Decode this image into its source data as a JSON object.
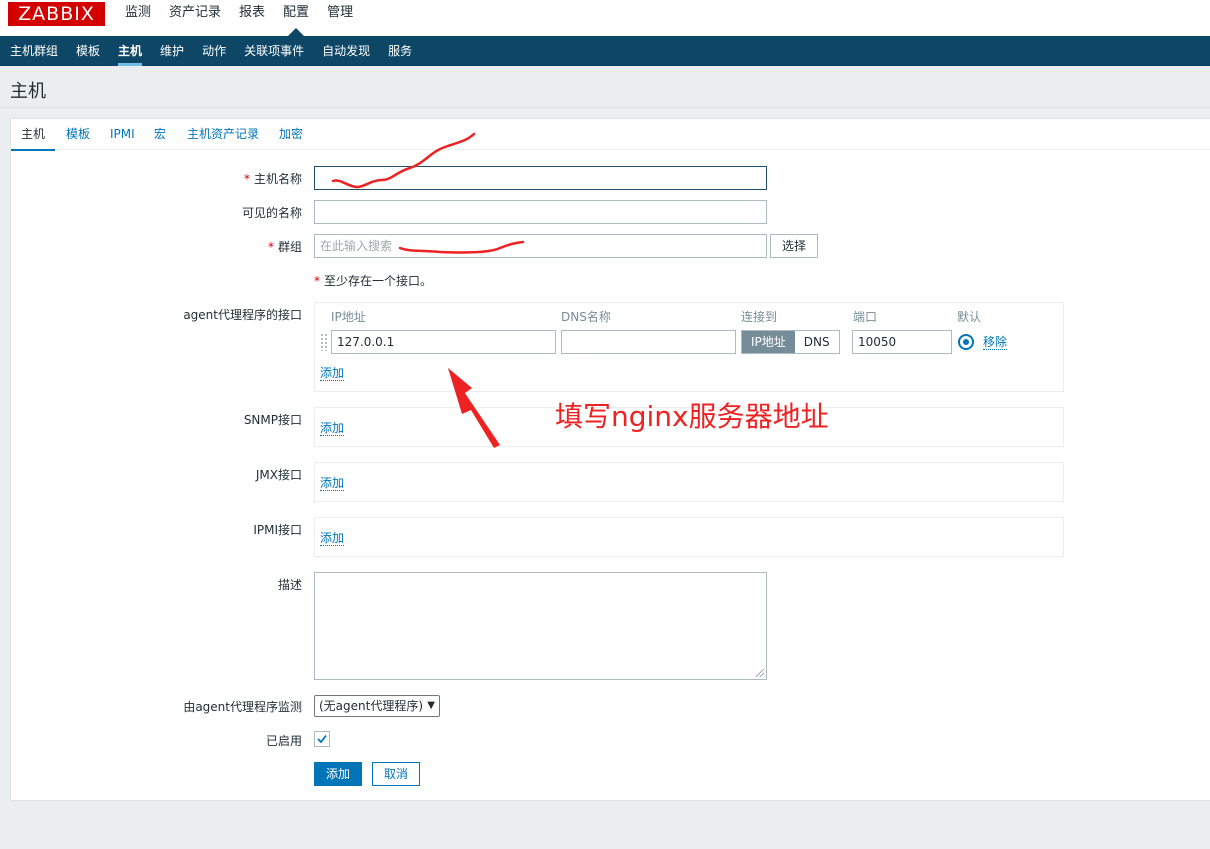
{
  "brand": {
    "logo_text": "ZABBIX"
  },
  "main_menu": [
    {
      "label": "监测"
    },
    {
      "label": "资产记录"
    },
    {
      "label": "报表"
    },
    {
      "label": "配置",
      "active": true
    },
    {
      "label": "管理"
    }
  ],
  "sub_menu": [
    {
      "label": "主机群组"
    },
    {
      "label": "模板"
    },
    {
      "label": "主机",
      "active": true
    },
    {
      "label": "维护"
    },
    {
      "label": "动作"
    },
    {
      "label": "关联项事件"
    },
    {
      "label": "自动发现"
    },
    {
      "label": "服务"
    }
  ],
  "page": {
    "title": "主机"
  },
  "tabs": [
    {
      "label": "主机",
      "active": true
    },
    {
      "label": "模板"
    },
    {
      "label": "IPMI"
    },
    {
      "label": "宏"
    },
    {
      "label": "主机资产记录"
    },
    {
      "label": "加密"
    }
  ],
  "form": {
    "required_mark": "*",
    "host_name": {
      "label": "主机名称",
      "value": ""
    },
    "visible_name": {
      "label": "可见的名称",
      "value": ""
    },
    "groups": {
      "label": "群组",
      "placeholder": "在此输入搜索",
      "select_button": "选择"
    },
    "interface_note": "至少存在一个接口。",
    "agent_interfaces": {
      "label": "agent代理程序的接口",
      "headers": {
        "ip": "IP地址",
        "dns": "DNS名称",
        "connect_to": "连接到",
        "port": "端口",
        "default": "默认"
      },
      "row": {
        "ip": "127.0.0.1",
        "dns": "",
        "connect_ip": "IP地址",
        "connect_dns": "DNS",
        "port": "10050",
        "remove": "移除"
      },
      "add": "添加"
    },
    "snmp_interfaces": {
      "label": "SNMP接口",
      "add": "添加"
    },
    "jmx_interfaces": {
      "label": "JMX接口",
      "add": "添加"
    },
    "ipmi_interfaces": {
      "label": "IPMI接口",
      "add": "添加"
    },
    "description": {
      "label": "描述",
      "value": ""
    },
    "monitored_by_proxy": {
      "label": "由agent代理程序监测",
      "selected": "(无agent代理程序)"
    },
    "enabled": {
      "label": "已启用",
      "checked": true
    },
    "buttons": {
      "add": "添加",
      "cancel": "取消"
    }
  },
  "annotation": {
    "text": "填写nginx服务器地址",
    "color": "#ee2222"
  },
  "colors": {
    "brand": "#d40000",
    "nav": "#0e4766",
    "link": "#0275b8",
    "annotation": "#ee2222"
  }
}
